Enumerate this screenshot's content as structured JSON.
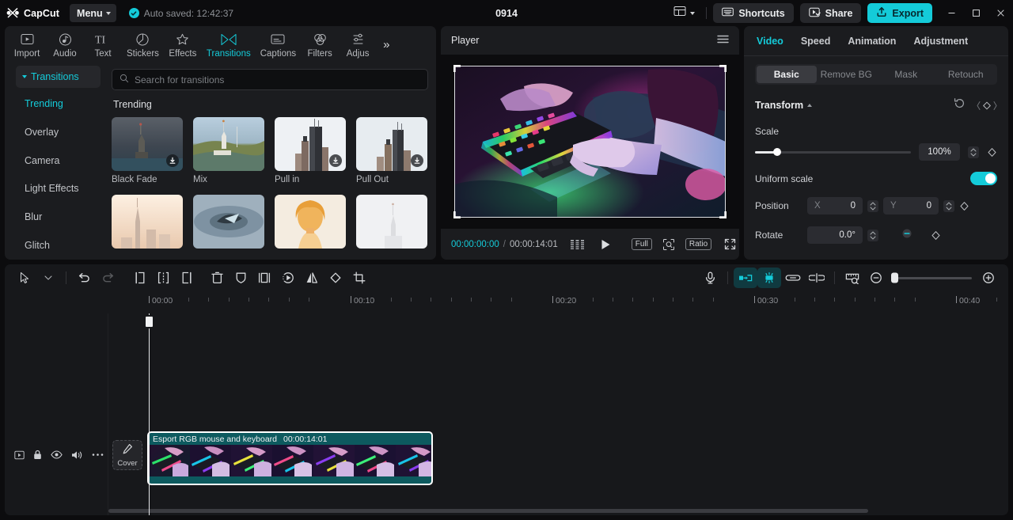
{
  "titlebar": {
    "brand": "CapCut",
    "menu_label": "Menu",
    "autosave_text": "Auto saved: 12:42:37",
    "project_title": "0914",
    "shortcuts_label": "Shortcuts",
    "share_label": "Share",
    "export_label": "Export",
    "accent": "#14cbd9"
  },
  "tabs": [
    {
      "label": "Import",
      "icon": "import-icon",
      "active": false
    },
    {
      "label": "Audio",
      "icon": "audio-icon",
      "active": false
    },
    {
      "label": "Text",
      "icon": "text-icon",
      "active": false
    },
    {
      "label": "Stickers",
      "icon": "stickers-icon",
      "active": false
    },
    {
      "label": "Effects",
      "icon": "effects-icon",
      "active": false
    },
    {
      "label": "Transitions",
      "icon": "transitions-icon",
      "active": true
    },
    {
      "label": "Captions",
      "icon": "captions-icon",
      "active": false
    },
    {
      "label": "Filters",
      "icon": "filters-icon",
      "active": false
    },
    {
      "label": "Adjus",
      "icon": "adjustment-icon",
      "active": false
    }
  ],
  "tabs_overflow": "»",
  "sidebar": {
    "header": "Transitions",
    "items": [
      {
        "label": "Trending",
        "active": true
      },
      {
        "label": "Overlay",
        "active": false
      },
      {
        "label": "Camera",
        "active": false
      },
      {
        "label": "Light Effects",
        "active": false
      },
      {
        "label": "Blur",
        "active": false
      },
      {
        "label": "Glitch",
        "active": false
      }
    ]
  },
  "library": {
    "search_placeholder": "Search for transitions",
    "section_title": "Trending",
    "items": [
      {
        "label": "Black Fade",
        "download": true
      },
      {
        "label": "Mix",
        "download": false
      },
      {
        "label": "Pull in",
        "download": true
      },
      {
        "label": "Pull Out",
        "download": true
      }
    ]
  },
  "player": {
    "title": "Player",
    "current_time": "00:00:00:00",
    "separator": "/",
    "total_time": "00:00:14:01",
    "full_label": "Full",
    "ratio_label": "Ratio"
  },
  "inspector": {
    "tabs": [
      {
        "label": "Video",
        "active": true
      },
      {
        "label": "Speed",
        "active": false
      },
      {
        "label": "Animation",
        "active": false
      },
      {
        "label": "Adjustment",
        "active": false
      }
    ],
    "segments": [
      {
        "label": "Basic",
        "active": true
      },
      {
        "label": "Remove BG",
        "active": false
      },
      {
        "label": "Mask",
        "active": false
      },
      {
        "label": "Retouch",
        "active": false
      }
    ],
    "transform_title": "Transform",
    "scale_label": "Scale",
    "scale_value": "100%",
    "uniform_scale_label": "Uniform scale",
    "uniform_scale_on": true,
    "position_label": "Position",
    "position_x_axis": "X",
    "position_x_value": "0",
    "position_y_axis": "Y",
    "position_y_value": "0",
    "rotate_label": "Rotate",
    "rotate_value": "0.0°"
  },
  "timeline": {
    "ruler_labels": [
      "00:00",
      "00:10",
      "00:20",
      "00:30",
      "00:40"
    ],
    "cover_label": "Cover",
    "clip": {
      "name": "Esport RGB mouse and keyboard",
      "duration": "00:00:14:01"
    }
  }
}
